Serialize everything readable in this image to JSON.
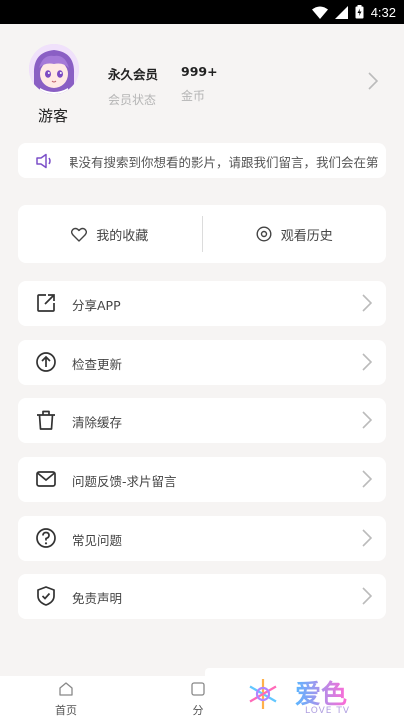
{
  "status_bar": {
    "time": "4:32"
  },
  "profile": {
    "username": "游客",
    "membership_value": "永久会员",
    "membership_label": "会员状态",
    "coins_value": "999+",
    "coins_label": "金币"
  },
  "notice": {
    "text": "果没有搜索到你想看的影片，请跟我们留言，我们会在第"
  },
  "tabs": {
    "favorites": "我的收藏",
    "history": "观看历史"
  },
  "menu": [
    {
      "label": "分享APP",
      "icon": "share-icon"
    },
    {
      "label": "检查更新",
      "icon": "upload-icon"
    },
    {
      "label": "清除缓存",
      "icon": "trash-icon"
    },
    {
      "label": "问题反馈-求片留言",
      "icon": "mail-icon"
    },
    {
      "label": "常见问题",
      "icon": "help-icon"
    },
    {
      "label": "免责声明",
      "icon": "shield-icon"
    }
  ],
  "bottom_nav": {
    "home": "首页",
    "category": "分"
  },
  "watermark": {
    "title": "爱色",
    "subtitle": "LOVE TV"
  },
  "colors": {
    "accent": "#7b4fc8",
    "background": "#f6f4f3"
  }
}
